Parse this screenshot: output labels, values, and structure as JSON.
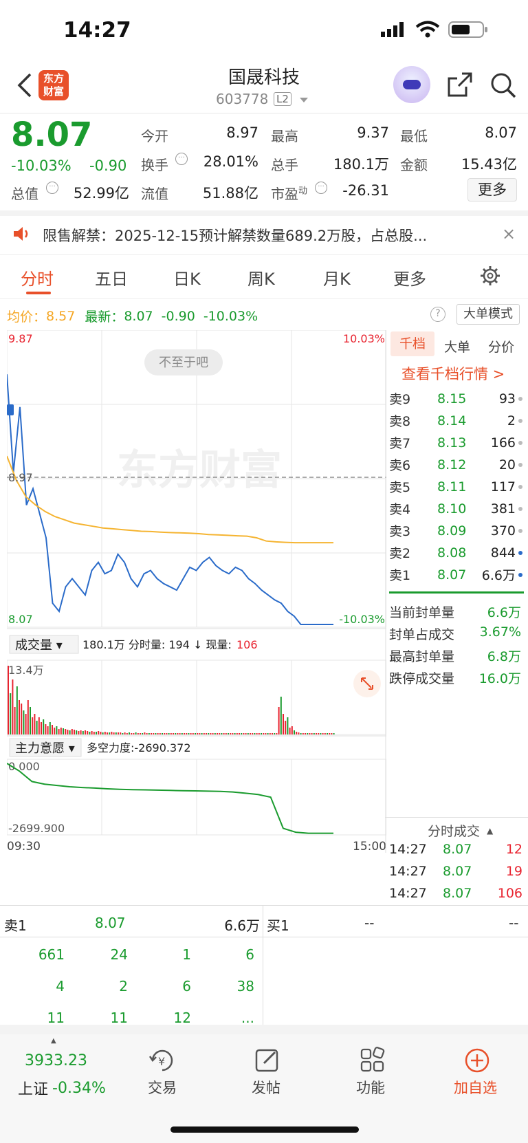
{
  "status": {
    "time": "14:27"
  },
  "header": {
    "title": "国晟科技",
    "code": "603778",
    "level": "L2",
    "logo_text": "东方\n财富"
  },
  "quote": {
    "price": "8.07",
    "change_pct": "-10.03%",
    "change": "-0.90",
    "open_label": "今开",
    "open": "8.97",
    "high_label": "最高",
    "high": "9.37",
    "low_label": "最低",
    "low": "8.07",
    "turnover_label": "换手",
    "turnover": "28.01%",
    "volume_label": "总手",
    "volume": "180.1万",
    "amount_label": "金额",
    "amount": "15.43亿",
    "mktcap_label": "总值",
    "mktcap": "52.99亿",
    "float_label": "流值",
    "float": "51.88亿",
    "pe_label": "市盈",
    "pe_sup": "动",
    "pe": "-26.31",
    "more_button": "更多"
  },
  "notice": {
    "text": "限售解禁：2025-12-15预计解禁数量689.2万股，占总股..."
  },
  "tabs": [
    "分时",
    "五日",
    "日K",
    "周K",
    "月K",
    "更多"
  ],
  "chart_header": {
    "avg_label": "均价：",
    "avg": "8.57",
    "latest_label": "最新：",
    "latest": "8.07",
    "change": "-0.90",
    "change_pct": "-10.03%",
    "big_mode": "大单模式"
  },
  "chart_data": {
    "type": "line",
    "ylim": [
      8.07,
      9.87
    ],
    "y_top_label": "9.87",
    "y_bottom_label": "8.07",
    "y_mid_label": "8.97",
    "pct_top": "10.03%",
    "pct_bottom": "-10.03%",
    "x_start": "09:30",
    "x_end": "15:00",
    "tooltip": "不至于吧",
    "watermark": "东方财富",
    "series": [
      {
        "name": "价格",
        "color": "#2a6bc9",
        "values": [
          9.6,
          9.0,
          9.4,
          8.8,
          8.9,
          8.75,
          8.6,
          8.2,
          8.15,
          8.3,
          8.35,
          8.3,
          8.25,
          8.4,
          8.45,
          8.38,
          8.4,
          8.5,
          8.45,
          8.35,
          8.3,
          8.38,
          8.4,
          8.35,
          8.32,
          8.3,
          8.28,
          8.35,
          8.42,
          8.4,
          8.45,
          8.48,
          8.43,
          8.4,
          8.38,
          8.42,
          8.4,
          8.35,
          8.32,
          8.28,
          8.25,
          8.22,
          8.2,
          8.15,
          8.12,
          8.07,
          8.07,
          8.07,
          8.07,
          8.07,
          8.07
        ]
      },
      {
        "name": "均价",
        "color": "#f5b431",
        "values": [
          9.1,
          8.95,
          8.85,
          8.8,
          8.76,
          8.73,
          8.71,
          8.69,
          8.68,
          8.67,
          8.66,
          8.655,
          8.65,
          8.645,
          8.64,
          8.638,
          8.635,
          8.632,
          8.63,
          8.628,
          8.625,
          8.62,
          8.618,
          8.615,
          8.612,
          8.61,
          8.6,
          8.58,
          8.575,
          8.572,
          8.57,
          8.57,
          8.57,
          8.57,
          8.57
        ]
      }
    ],
    "volume": {
      "label": "成交量",
      "total": "180.1万",
      "minute_label": "分时量:",
      "minute": "194",
      "now_label": "现量:",
      "now": "106",
      "max": "13.4万"
    },
    "capital": {
      "label": "主力意愿",
      "power_label": "多空力度:",
      "power": "-2690.372",
      "top": "0.000",
      "bottom": "-2699.900",
      "values": [
        0,
        -300,
        -700,
        -800,
        -850,
        -900,
        -930,
        -950,
        -980,
        -1000,
        -1010,
        -1020,
        -1030,
        -1040,
        -1050,
        -1060,
        -1070,
        -1080,
        -1100,
        -1150,
        -1200,
        -1300,
        -2500,
        -2650,
        -2690,
        -2690,
        -2690
      ]
    }
  },
  "orderbook": {
    "tabs": [
      "千档",
      "大单",
      "分价"
    ],
    "link": "查看千档行情 >",
    "asks": [
      {
        "label": "卖9",
        "price": "8.15",
        "vol": "93"
      },
      {
        "label": "卖8",
        "price": "8.14",
        "vol": "2"
      },
      {
        "label": "卖7",
        "price": "8.13",
        "vol": "166"
      },
      {
        "label": "卖6",
        "price": "8.12",
        "vol": "20"
      },
      {
        "label": "卖5",
        "price": "8.11",
        "vol": "117"
      },
      {
        "label": "卖4",
        "price": "8.10",
        "vol": "381"
      },
      {
        "label": "卖3",
        "price": "8.09",
        "vol": "370"
      },
      {
        "label": "卖2",
        "price": "8.08",
        "vol": "844"
      },
      {
        "label": "卖1",
        "price": "8.07",
        "vol": "6.6万"
      }
    ],
    "stats": [
      {
        "label": "当前封单量",
        "value": "6.6万"
      },
      {
        "label": "封单占成交",
        "value": "3.67%"
      },
      {
        "label": "最高封单量",
        "value": "6.8万"
      },
      {
        "label": "跌停成交量",
        "value": "16.0万"
      }
    ],
    "trades_title": "分时成交",
    "trades": [
      {
        "time": "14:27",
        "price": "8.07",
        "vol": "12"
      },
      {
        "time": "14:27",
        "price": "8.07",
        "vol": "19"
      },
      {
        "time": "14:27",
        "price": "8.07",
        "vol": "106"
      }
    ]
  },
  "queue": {
    "sell_label": "卖1",
    "sell_price": "8.07",
    "sell_vol": "6.6万",
    "buy_label": "买1",
    "buy_price": "--",
    "buy_vol": "--",
    "rows": [
      [
        "661",
        "24",
        "1",
        "6"
      ],
      [
        "4",
        "2",
        "6",
        "38"
      ],
      [
        "11",
        "11",
        "12",
        "..."
      ]
    ]
  },
  "bottom_nav": {
    "index_value": "3933.23",
    "index_name": "上证",
    "index_change": "-0.34%",
    "items": [
      "交易",
      "发帖",
      "功能",
      "加自选"
    ]
  }
}
